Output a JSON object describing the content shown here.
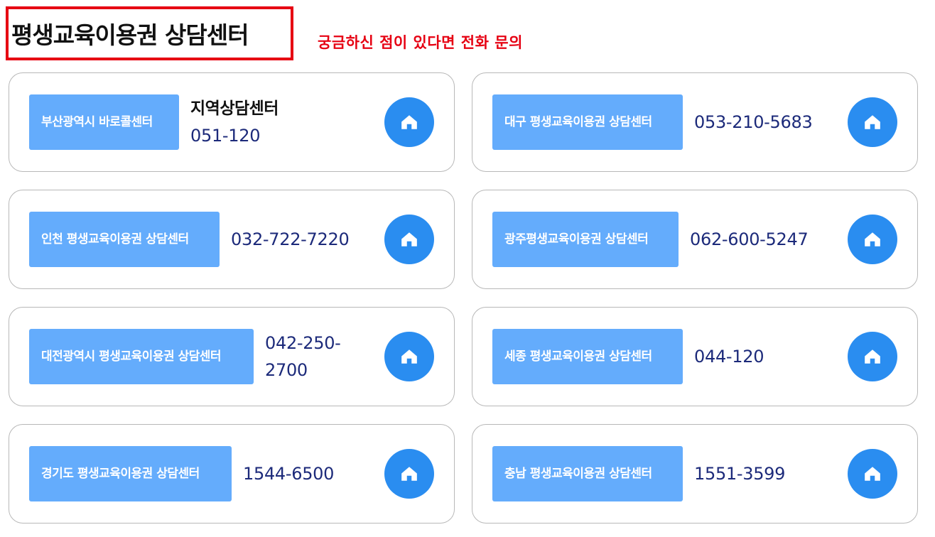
{
  "header": {
    "title": "평생교육이용권 상담센터",
    "subtitle": "궁금하신 점이 있다면 전화 문의"
  },
  "cards": [
    {
      "name": "부산광역시 바로콜센터",
      "region_label": "지역상담센터",
      "phone": "051-120",
      "icon": "home-icon"
    },
    {
      "name": "대구 평생교육이용권 상담센터",
      "region_label": "",
      "phone": "053-210-5683",
      "icon": "home-icon"
    },
    {
      "name": "인천 평생교육이용권 상담센터",
      "region_label": "",
      "phone": "032-722-7220",
      "icon": "home-icon"
    },
    {
      "name": "광주평생교육이용권 상담센터",
      "region_label": "",
      "phone": "062-600-5247",
      "icon": "home-icon"
    },
    {
      "name": "대전광역시 평생교육이용권 상담센터",
      "region_label": "",
      "phone": "042-250-2700",
      "icon": "home-icon"
    },
    {
      "name": "세종 평생교육이용권 상담센터",
      "region_label": "",
      "phone": "044-120",
      "icon": "home-icon"
    },
    {
      "name": "경기도 평생교육이용권 상담센터",
      "region_label": "",
      "phone": "1544-6500",
      "icon": "home-icon"
    },
    {
      "name": "충남 평생교육이용권 상담센터",
      "region_label": "",
      "phone": "1551-3599",
      "icon": "home-icon"
    }
  ],
  "colors": {
    "accent_red": "#e60012",
    "button_blue": "#64acfc",
    "home_blue": "#2a8df0",
    "phone_navy": "#1c2a7a"
  }
}
